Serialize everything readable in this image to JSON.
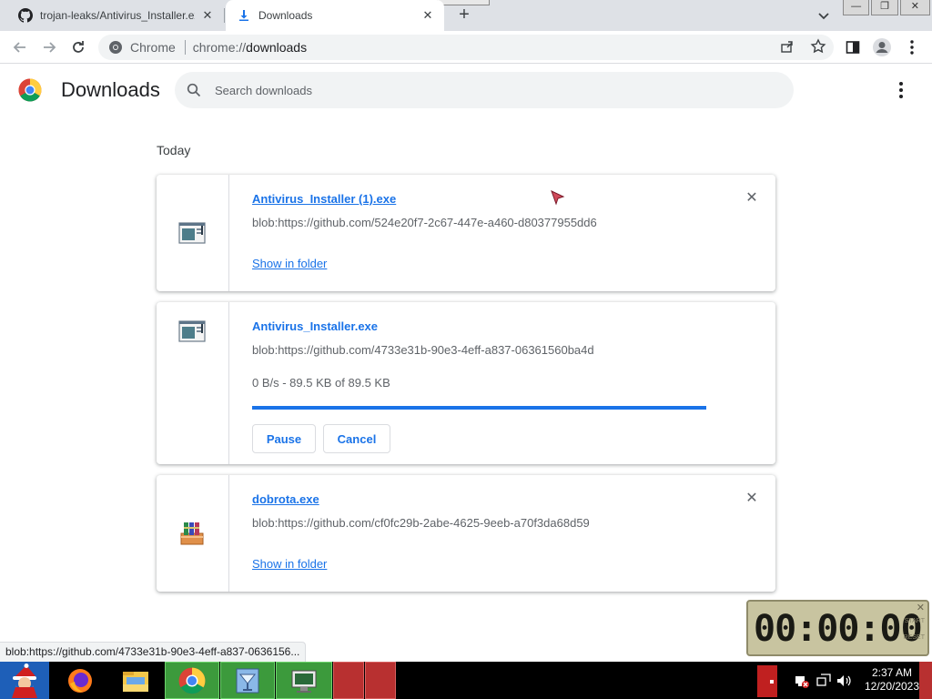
{
  "browser": {
    "tabs": [
      {
        "title": "trojan-leaks/Antivirus_Installer.ex",
        "icon": "github-icon",
        "active": false
      },
      {
        "title": "Downloads",
        "icon": "download-icon",
        "active": true
      }
    ],
    "omnibox": {
      "label": "Chrome",
      "scheme": "chrome://",
      "host": "downloads"
    },
    "window_controls": {
      "minimize": "—",
      "restore": "❐",
      "close": "✕"
    }
  },
  "downloads": {
    "title": "Downloads",
    "search_placeholder": "Search downloads",
    "section_date": "Today",
    "items": [
      {
        "name": "Antivirus_Installer (1).exe",
        "url": "blob:https://github.com/524e20f7-2c67-447e-a460-d80377955dd6",
        "action": "Show in folder",
        "icon": "exe-window-icon"
      },
      {
        "name": "Antivirus_Installer.exe",
        "url": "blob:https://github.com/4733e31b-90e3-4eff-a837-06361560ba4d",
        "status": "0 B/s - 89.5 KB of 89.5 KB",
        "progress": 1.0,
        "pause_label": "Pause",
        "cancel_label": "Cancel",
        "icon": "exe-window-icon"
      },
      {
        "name": "dobrota.exe",
        "url": "blob:https://github.com/cf0fc29b-2abe-4625-9eeb-a70f3da68d59",
        "action": "Show in folder",
        "icon": "winrar-archive-icon"
      }
    ]
  },
  "status_bubble": "blob:https://github.com/4733e31b-90e3-4eff-a837-0636156...",
  "clock_widget": {
    "display": "00:00:00",
    "close": "✕",
    "side_top": "START",
    "side_bottom": "RESET"
  },
  "taskbar": {
    "time": "2:37 AM",
    "date": "12/20/2023",
    "apps": [
      "santa-start-icon",
      "firefox-icon",
      "file-explorer-icon",
      "chrome-icon",
      "cocktail-app-icon",
      "monitor-app-icon",
      "red-app-1",
      "red-app-2"
    ]
  },
  "colors": {
    "accent": "#1a73e8",
    "tab_strip": "#dee1e6",
    "taskbar": "#000000"
  }
}
